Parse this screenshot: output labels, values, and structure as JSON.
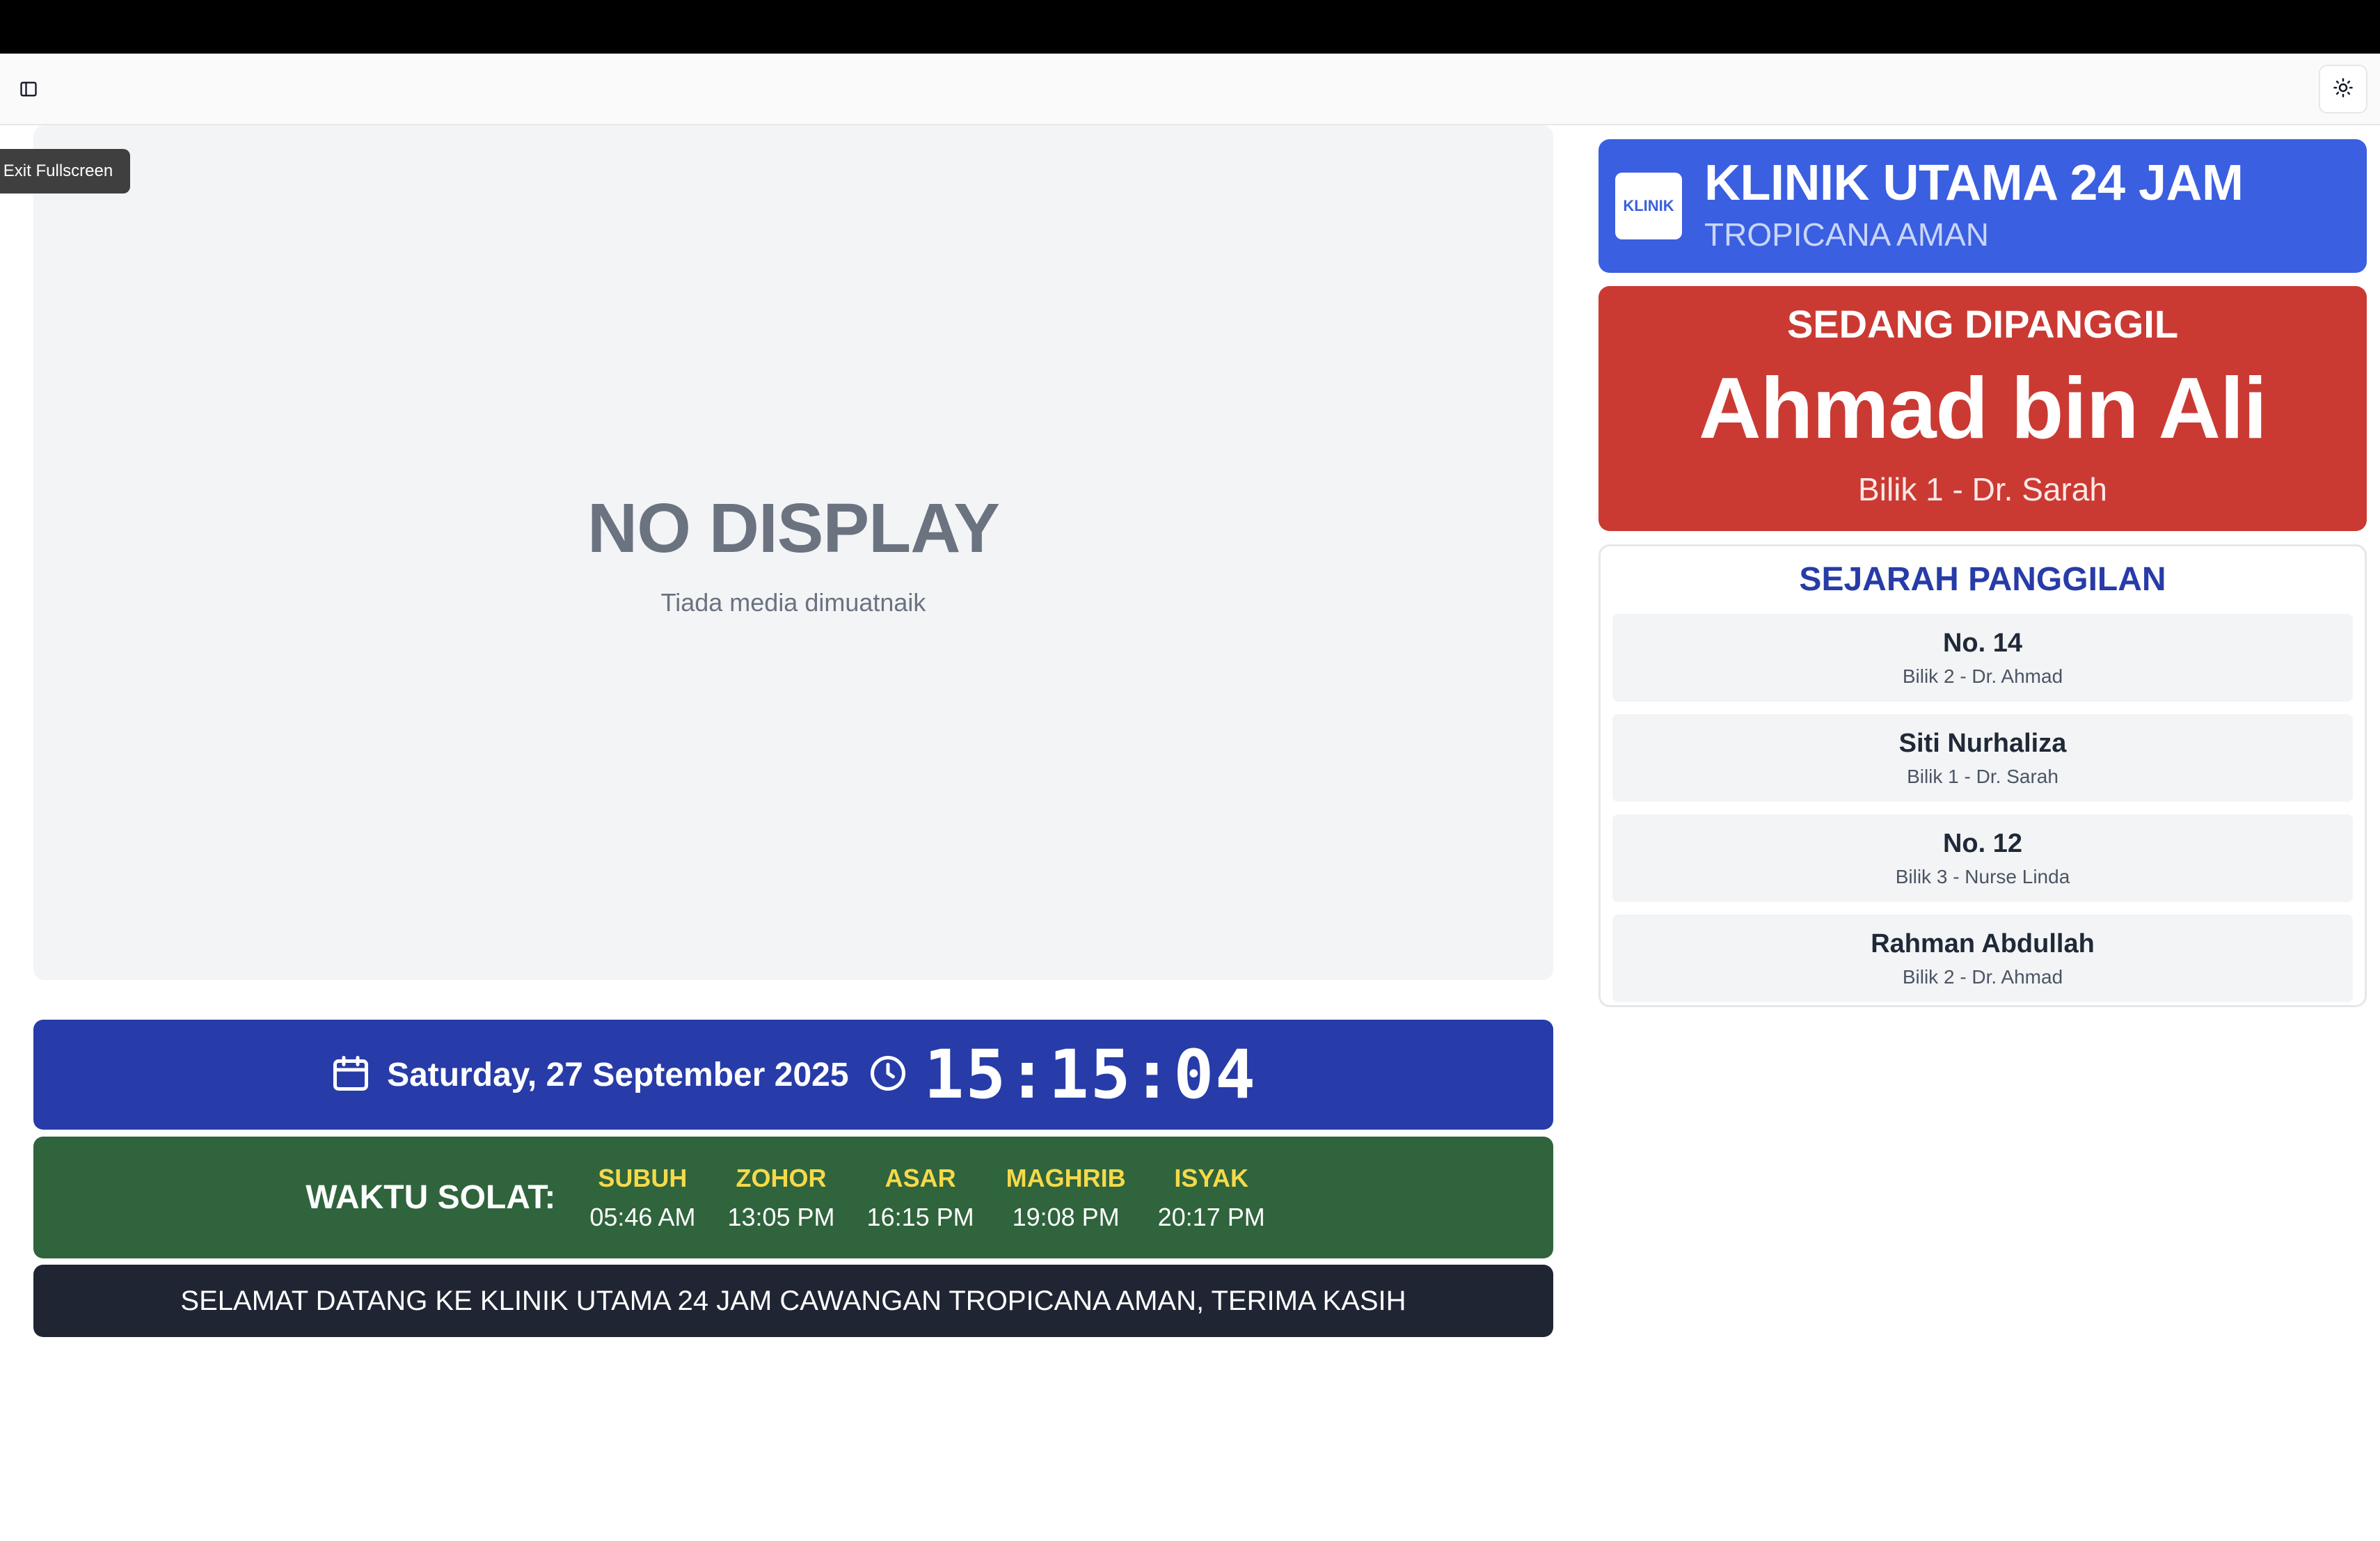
{
  "tooltip": {
    "exit_fullscreen": "Exit Fullscreen"
  },
  "icons": {
    "sidebar": "sidebar-toggle-icon",
    "theme": "sun-icon",
    "calendar": "calendar-icon",
    "clock": "clock-icon"
  },
  "media": {
    "title": "NO DISPLAY",
    "subtitle": "Tiada media dimuatnaik"
  },
  "datetime": {
    "date": "Saturday, 27 September 2025",
    "time": "15:15:04"
  },
  "prayer": {
    "label": "WAKTU SOLAT:",
    "times": [
      {
        "name": "SUBUH",
        "time": "05:46 AM"
      },
      {
        "name": "ZOHOR",
        "time": "13:05 PM"
      },
      {
        "name": "ASAR",
        "time": "16:15 PM"
      },
      {
        "name": "MAGHRIB",
        "time": "19:08 PM"
      },
      {
        "name": "ISYAK",
        "time": "20:17 PM"
      }
    ]
  },
  "ticker": {
    "text": "SELAMAT DATANG KE KLINIK UTAMA 24 JAM CAWANGAN TROPICANA AMAN, TERIMA KASIH"
  },
  "clinic": {
    "logo_text": "KLINIK",
    "name": "KLINIK UTAMA 24 JAM",
    "branch": "TROPICANA AMAN"
  },
  "calling": {
    "label": "SEDANG DIPANGGIL",
    "name": "Ahmad bin Ali",
    "room": "Bilik 1 - Dr. Sarah"
  },
  "history": {
    "title": "SEJARAH PANGGILAN",
    "items": [
      {
        "name": "No. 14",
        "room": "Bilik 2 - Dr. Ahmad"
      },
      {
        "name": "Siti Nurhaliza",
        "room": "Bilik 1 - Dr. Sarah"
      },
      {
        "name": "No. 12",
        "room": "Bilik 3 - Nurse Linda"
      },
      {
        "name": "Rahman Abdullah",
        "room": "Bilik 2 - Dr. Ahmad"
      }
    ]
  },
  "colors": {
    "clinic_header": "#3a5fe0",
    "calling_bg": "#ca3a33",
    "datetime_bg": "#273ca8",
    "prayer_bg": "#2f643c",
    "prayer_name": "#f6d94a",
    "ticker_bg": "#1f2533"
  }
}
